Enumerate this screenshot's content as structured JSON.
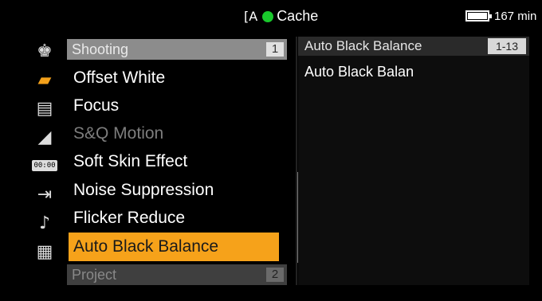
{
  "status": {
    "media_icon": "media-slot-icon",
    "media_glyph": "[A",
    "rec_color": "#19c82c",
    "cache_label": "Cache",
    "battery_icon": "battery-icon",
    "time_remaining": "167 min"
  },
  "sidebar": {
    "icons": [
      {
        "name": "user-menu-icon",
        "glyph": "♚"
      },
      {
        "name": "camera-shooting-icon",
        "glyph": "▰"
      },
      {
        "name": "clapperboard-icon",
        "glyph": "▤"
      },
      {
        "name": "paint-icon",
        "glyph": "◢"
      },
      {
        "name": "timecode-icon",
        "glyph": "00:00"
      },
      {
        "name": "output-icon",
        "glyph": "⇥"
      },
      {
        "name": "audio-note-icon",
        "glyph": "♪"
      },
      {
        "name": "grid-icon",
        "glyph": "▦"
      }
    ]
  },
  "menu": {
    "section_top": {
      "label": "Shooting",
      "number": "1"
    },
    "items": [
      {
        "label": "Offset White",
        "state": "normal"
      },
      {
        "label": "Focus",
        "state": "normal"
      },
      {
        "label": "S&Q Motion",
        "state": "disabled"
      },
      {
        "label": "Soft Skin Effect",
        "state": "normal"
      },
      {
        "label": "Noise Suppression",
        "state": "normal"
      },
      {
        "label": "Flicker Reduce",
        "state": "normal"
      },
      {
        "label": "Auto Black Balance",
        "state": "selected"
      }
    ],
    "section_bottom": {
      "label": "Project",
      "number": "2"
    }
  },
  "detail": {
    "title": "Auto Black Balance",
    "code": "1-13",
    "value": "Auto Black Balan"
  },
  "colors": {
    "accent": "#f6a21a",
    "rec": "#19c82c"
  }
}
